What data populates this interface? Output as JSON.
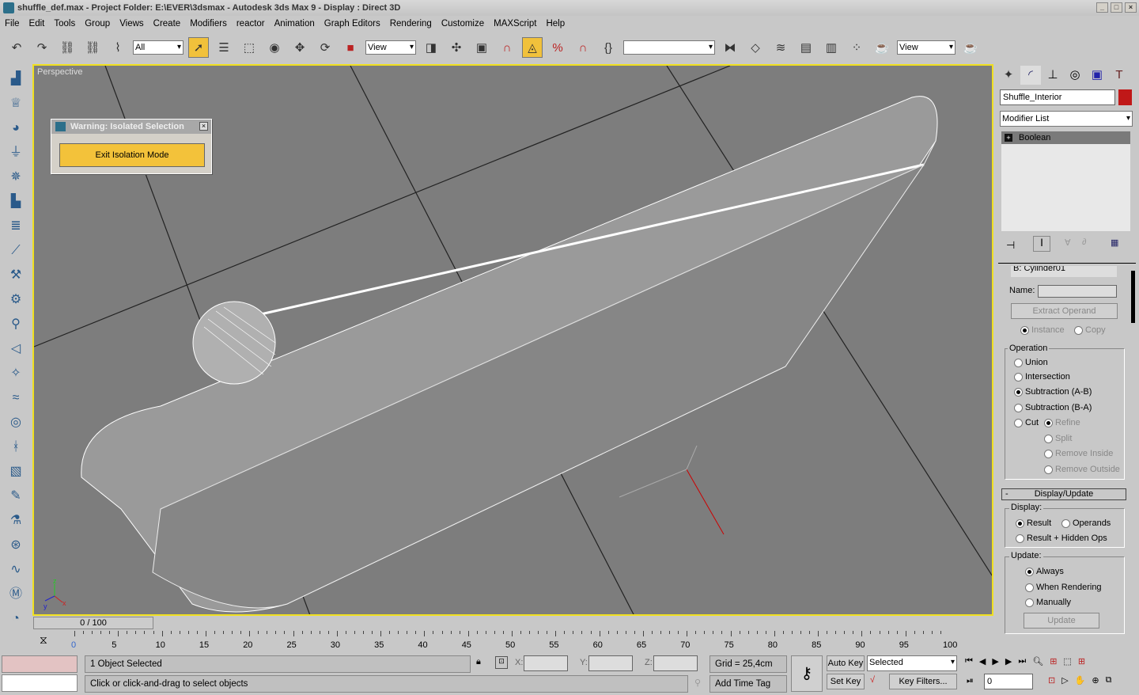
{
  "title": {
    "text": "shuffle_def.max    - Project Folder: E:\\EVER\\3dsmax    - Autodesk 3ds Max 9    - Display : Direct 3D"
  },
  "menu": [
    "File",
    "Edit",
    "Tools",
    "Group",
    "Views",
    "Create",
    "Modifiers",
    "reactor",
    "Animation",
    "Graph Editors",
    "Rendering",
    "Customize",
    "MAXScript",
    "Help"
  ],
  "toolbar": {
    "selection_filter": "All",
    "ref_coord": "View",
    "named_selection": "",
    "render_view": "View"
  },
  "viewport": {
    "label": "Perspective",
    "axis_labels": {
      "x": "x",
      "y": "y",
      "z": "z"
    }
  },
  "warning": {
    "title": "Warning: Isolated Selection",
    "button": "Exit Isolation Mode"
  },
  "command_panel": {
    "object_name": "Shuffle_Interior",
    "object_color": "#c01818",
    "modifier_list": "Modifier List",
    "stack": [
      "Boolean"
    ],
    "operand": "B: Cylinder01",
    "name_label": "Name:",
    "name_value": "",
    "extract": "Extract Operand",
    "instance": "Instance",
    "copy": "Copy",
    "operation": {
      "label": "Operation",
      "union": "Union",
      "intersection": "Intersection",
      "sub_ab": "Subtraction (A-B)",
      "sub_ba": "Subtraction (B-A)",
      "cut": "Cut",
      "refine": "Refine",
      "split": "Split",
      "remove_inside": "Remove Inside",
      "remove_outside": "Remove Outside",
      "selected": "Subtraction (A-B)"
    },
    "display_update": {
      "title": "Display/Update",
      "collapse": "-",
      "display_label": "Display:",
      "result": "Result",
      "operands": "Operands",
      "result_hidden": "Result + Hidden Ops",
      "update_label": "Update:",
      "always": "Always",
      "when_rendering": "When Rendering",
      "manually": "Manually",
      "update_btn": "Update"
    }
  },
  "time": {
    "slider": "0 / 100",
    "ticks": [
      "0",
      "5",
      "10",
      "15",
      "20",
      "25",
      "30",
      "35",
      "40",
      "45",
      "50",
      "55",
      "60",
      "65",
      "70",
      "75",
      "80",
      "85",
      "90",
      "95",
      "100"
    ]
  },
  "status": {
    "selected": "1 Object Selected",
    "prompt": "Click or click-and-drag to select objects",
    "x": "X:",
    "y": "Y:",
    "z": "Z:",
    "grid": "Grid = 25,4cm",
    "add_time_tag": "Add Time Tag",
    "auto_key": "Auto Key",
    "set_key": "Set Key",
    "key_mode": "Selected",
    "key_filters": "Key Filters...",
    "frame": "0"
  }
}
